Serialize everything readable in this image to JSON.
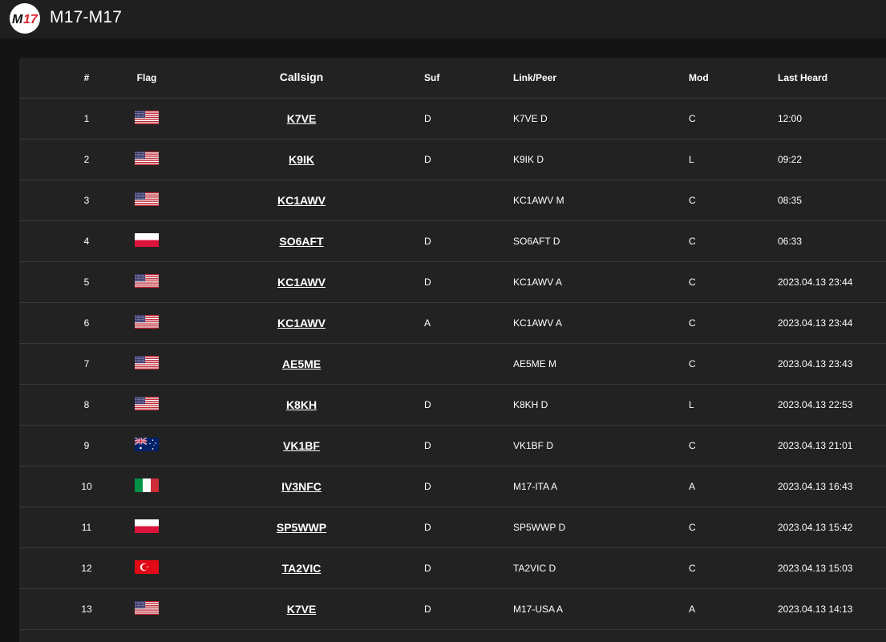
{
  "app": {
    "title": "M17-M17",
    "logo_text": "M17"
  },
  "table": {
    "headers": {
      "num": "#",
      "flag": "Flag",
      "callsign": "Callsign",
      "suf": "Suf",
      "link": "Link/Peer",
      "mod": "Mod",
      "last": "Last Heard"
    },
    "rows": [
      {
        "num": "1",
        "flag": "us",
        "callsign": "K7VE",
        "suf": "D",
        "link": "K7VE D",
        "mod": "C",
        "last": "12:00"
      },
      {
        "num": "2",
        "flag": "us",
        "callsign": "K9IK",
        "suf": "D",
        "link": "K9IK D",
        "mod": "L",
        "last": "09:22"
      },
      {
        "num": "3",
        "flag": "us",
        "callsign": "KC1AWV",
        "suf": "",
        "link": "KC1AWV M",
        "mod": "C",
        "last": "08:35"
      },
      {
        "num": "4",
        "flag": "pl",
        "callsign": "SO6AFT",
        "suf": "D",
        "link": "SO6AFT D",
        "mod": "C",
        "last": "06:33"
      },
      {
        "num": "5",
        "flag": "us",
        "callsign": "KC1AWV",
        "suf": "D",
        "link": "KC1AWV A",
        "mod": "C",
        "last": "2023.04.13 23:44"
      },
      {
        "num": "6",
        "flag": "us",
        "callsign": "KC1AWV",
        "suf": "A",
        "link": "KC1AWV A",
        "mod": "C",
        "last": "2023.04.13 23:44"
      },
      {
        "num": "7",
        "flag": "us",
        "callsign": "AE5ME",
        "suf": "",
        "link": "AE5ME M",
        "mod": "C",
        "last": "2023.04.13 23:43"
      },
      {
        "num": "8",
        "flag": "us",
        "callsign": "K8KH",
        "suf": "D",
        "link": "K8KH D",
        "mod": "L",
        "last": "2023.04.13 22:53"
      },
      {
        "num": "9",
        "flag": "au",
        "callsign": "VK1BF",
        "suf": "D",
        "link": "VK1BF D",
        "mod": "C",
        "last": "2023.04.13 21:01"
      },
      {
        "num": "10",
        "flag": "it",
        "callsign": "IV3NFC",
        "suf": "D",
        "link": "M17-ITA A",
        "mod": "A",
        "last": "2023.04.13 16:43"
      },
      {
        "num": "11",
        "flag": "pl",
        "callsign": "SP5WWP",
        "suf": "D",
        "link": "SP5WWP D",
        "mod": "C",
        "last": "2023.04.13 15:42"
      },
      {
        "num": "12",
        "flag": "tr",
        "callsign": "TA2VIC",
        "suf": "D",
        "link": "TA2VIC D",
        "mod": "C",
        "last": "2023.04.13 15:03"
      },
      {
        "num": "13",
        "flag": "us",
        "callsign": "K7VE",
        "suf": "D",
        "link": "M17-USA A",
        "mod": "A",
        "last": "2023.04.13 14:13"
      }
    ]
  },
  "colors": {
    "background": "#141414",
    "topbar": "#1f1f1f",
    "panel": "#222222",
    "divider": "#3a3a3a",
    "logo_red": "#d8232a"
  }
}
